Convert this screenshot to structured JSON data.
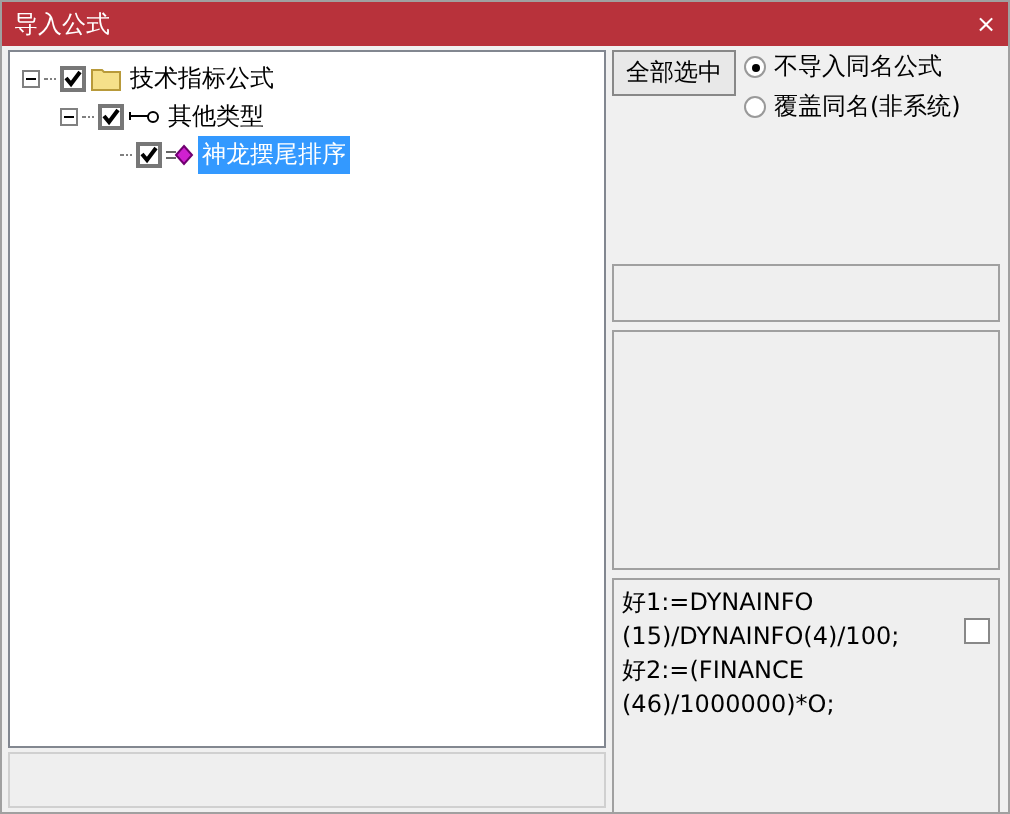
{
  "window": {
    "title": "导入公式",
    "close": "×"
  },
  "tree": [
    {
      "label": "技术指标公式",
      "kind": "folder",
      "checked": true,
      "expanded": true,
      "selected": false,
      "children": [
        {
          "label": "其他类型",
          "kind": "key",
          "checked": true,
          "expanded": true,
          "selected": false,
          "children": [
            {
              "label": "神龙摆尾排序",
              "kind": "formula",
              "checked": true,
              "selected": true
            }
          ]
        }
      ]
    }
  ],
  "select_all_button": "全部选中",
  "options": [
    {
      "label": "不导入同名公式",
      "selected": true
    },
    {
      "label": "覆盖同名(非系统)",
      "selected": false
    }
  ],
  "formula_text": [
    "好1:=DYNAINFO",
    "(15)/DYNAINFO(4)/100;",
    "好2:=(FINANCE",
    "(46)/1000000)*O;"
  ],
  "formula_checkbox": {
    "checked": false
  }
}
